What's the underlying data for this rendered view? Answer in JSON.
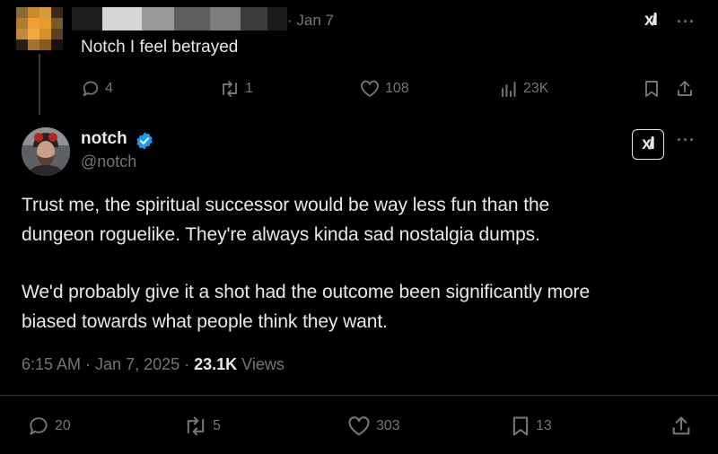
{
  "parent_tweet": {
    "date": "· Jan 7",
    "text": "Notch I feel betrayed",
    "grok_label": "x̸I",
    "more_label": "···",
    "actions": {
      "replies": "4",
      "reposts": "1",
      "likes": "108",
      "views": "23K"
    },
    "icons": [
      "reply-icon",
      "repost-icon",
      "like-icon",
      "views-icon",
      "bookmark-icon",
      "share-icon"
    ]
  },
  "main_tweet": {
    "display_name": "notch",
    "handle": "@notch",
    "grok_label": "x̸I",
    "more_label": "···",
    "body_lines": [
      "Trust me, the spiritual successor would be way less fun than the",
      "dungeon roguelike. They're always kinda sad nostalgia dumps.",
      "We'd probably give it a shot had the outcome been significantly more",
      "biased towards what people think they want."
    ],
    "timestamp": "6:15 AM · Jan 7, 2025 · ",
    "views_count": "23.1K",
    "views_label": " Views",
    "actions": {
      "replies": "20",
      "reposts": "5",
      "likes": "303",
      "bookmarks": "13"
    },
    "icons": [
      "verified-badge-icon",
      "reply-icon",
      "repost-icon",
      "like-icon",
      "bookmark-icon",
      "share-icon"
    ]
  },
  "colors": {
    "background": "#000000",
    "text": "#e7e9ea",
    "muted": "#71767b",
    "verified": "#1d9bf0",
    "divider": "#2f3336"
  }
}
